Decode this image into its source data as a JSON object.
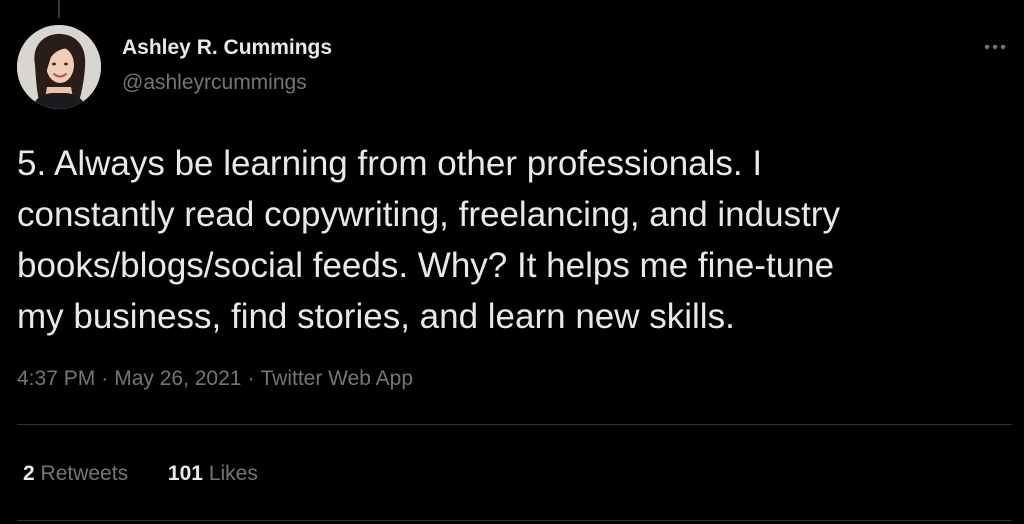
{
  "tweet": {
    "author": {
      "display_name": "Ashley R. Cummings",
      "handle": "@ashleyrcummings",
      "avatar_icon": "user-avatar-photo"
    },
    "more_icon": "more-options-icon",
    "text": "5. Always be learning from other professionals. I\nconstantly read copywriting, freelancing, and industry\nbooks/blogs/social feeds. Why? It helps me fine-tune\nmy business, find stories, and learn new skills.",
    "time": "4:37 PM",
    "date": "May 26, 2021",
    "source": "Twitter Web App",
    "separator": "·",
    "retweets": {
      "count": "2",
      "label": "Retweets"
    },
    "likes": {
      "count": "101",
      "label": "Likes"
    }
  },
  "colors": {
    "background": "#000000",
    "primary_text": "#e7e9ea",
    "secondary_text": "#71767b",
    "divider": "#2f3336"
  }
}
